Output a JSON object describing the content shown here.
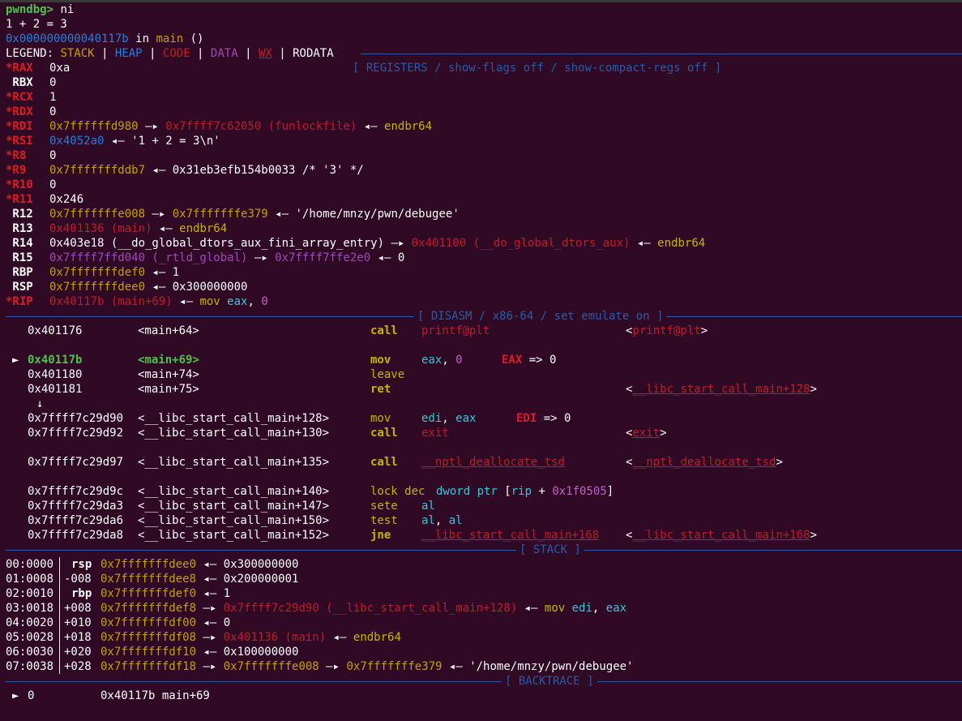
{
  "header": {
    "prompt": "pwndbg> ",
    "command": "ni",
    "output": "1 + 2 = 3",
    "location_addr": "0x000000000040117b",
    "location_in": " in ",
    "location_func": "main",
    "location_args": " ()"
  },
  "legend": {
    "label": "LEGEND: ",
    "stack": "STACK",
    "heap": "HEAP",
    "code": "CODE",
    "data": "DATA",
    "wx": "WX",
    "rodata": "RODATA",
    "sep": " | "
  },
  "sections": {
    "registers": "[ REGISTERS / show-flags off / show-compact-regs off ]",
    "disasm": "[ DISASM / x86-64 / set emulate on ]",
    "stack": "[ STACK ]",
    "backtrace": "[ BACKTRACE ]"
  },
  "colors": {
    "background": "#300a24",
    "separator": "#2a5aa8",
    "changed_register": "#e01b24",
    "stack": "#c4a000",
    "heap": "#2a7bde",
    "code": "#c01c28",
    "data": "#a347ba",
    "instruction": "#c4b500",
    "current": "#4ec24e"
  },
  "registers": [
    {
      "name": "*RAX",
      "changed": true,
      "parts": [
        {
          "t": "0xa",
          "c": "white"
        }
      ]
    },
    {
      "name": " RBX",
      "changed": false,
      "parts": [
        {
          "t": "0",
          "c": "white"
        }
      ]
    },
    {
      "name": "*RCX",
      "changed": true,
      "parts": [
        {
          "t": "1",
          "c": "white"
        }
      ]
    },
    {
      "name": "*RDX",
      "changed": true,
      "parts": [
        {
          "t": "0",
          "c": "white"
        }
      ]
    },
    {
      "name": "*RDI",
      "changed": true,
      "parts": [
        {
          "t": "0x7ffffffd980",
          "c": "stack"
        },
        {
          "t": " —▸ ",
          "c": "white"
        },
        {
          "t": "0x7ffff7c62050 (funlockfile)",
          "c": "code"
        },
        {
          "t": " ◂— ",
          "c": "white"
        },
        {
          "t": "endbr64",
          "c": "yellow"
        }
      ]
    },
    {
      "name": "*RSI",
      "changed": true,
      "parts": [
        {
          "t": "0x4052a0",
          "c": "heap"
        },
        {
          "t": " ◂— '1 + 2 = 3\\n'",
          "c": "white"
        }
      ]
    },
    {
      "name": "*R8",
      "changed": true,
      "parts": [
        {
          "t": "0",
          "c": "white"
        }
      ]
    },
    {
      "name": "*R9",
      "changed": true,
      "parts": [
        {
          "t": "0x7fffffffddb7",
          "c": "stack"
        },
        {
          "t": " ◂— 0x31eb3efb154b0033 /* '3' */",
          "c": "white"
        }
      ]
    },
    {
      "name": "*R10",
      "changed": true,
      "parts": [
        {
          "t": "0",
          "c": "white"
        }
      ]
    },
    {
      "name": "*R11",
      "changed": true,
      "parts": [
        {
          "t": "0x246",
          "c": "white"
        }
      ]
    },
    {
      "name": " R12",
      "changed": false,
      "parts": [
        {
          "t": "0x7fffffffe008",
          "c": "stack"
        },
        {
          "t": " —▸ ",
          "c": "white"
        },
        {
          "t": "0x7fffffffe379",
          "c": "stack"
        },
        {
          "t": " ◂— '/home/mnzy/pwn/debugee'",
          "c": "white"
        }
      ]
    },
    {
      "name": " R13",
      "changed": false,
      "parts": [
        {
          "t": "0x401136 (main)",
          "c": "code"
        },
        {
          "t": " ◂— ",
          "c": "white"
        },
        {
          "t": "endbr64",
          "c": "yellow"
        }
      ]
    },
    {
      "name": " R14",
      "changed": false,
      "parts": [
        {
          "t": "0x403e18 (__do_global_dtors_aux_fini_array_entry)",
          "c": "white"
        },
        {
          "t": " —▸ ",
          "c": "white"
        },
        {
          "t": "0x401100 (__do_global_dtors_aux)",
          "c": "code"
        },
        {
          "t": " ◂— ",
          "c": "white"
        },
        {
          "t": "endbr64",
          "c": "yellow"
        }
      ]
    },
    {
      "name": " R15",
      "changed": false,
      "parts": [
        {
          "t": "0x7ffff7ffd040 (_rtld_global)",
          "c": "data"
        },
        {
          "t": " —▸ ",
          "c": "white"
        },
        {
          "t": "0x7ffff7ffe2e0",
          "c": "data"
        },
        {
          "t": " ◂— 0",
          "c": "white"
        }
      ]
    },
    {
      "name": " RBP",
      "changed": false,
      "parts": [
        {
          "t": "0x7fffffffdef0",
          "c": "stack"
        },
        {
          "t": " ◂— 1",
          "c": "white"
        }
      ]
    },
    {
      "name": " RSP",
      "changed": false,
      "parts": [
        {
          "t": "0x7fffffffdee0",
          "c": "stack"
        },
        {
          "t": " ◂— 0x300000000",
          "c": "white"
        }
      ]
    },
    {
      "name": "*RIP",
      "changed": true,
      "parts": [
        {
          "t": "0x40117b (main+69)",
          "c": "code"
        },
        {
          "t": " ◂— ",
          "c": "white"
        },
        {
          "t": "mov ",
          "c": "yellow"
        },
        {
          "t": "eax",
          "c": "cyan"
        },
        {
          "t": ", ",
          "c": "white"
        },
        {
          "t": "0",
          "c": "purple"
        }
      ]
    }
  ],
  "disasm": [
    {
      "arrow": "",
      "addr": "0x401176",
      "sym": "<main+64>",
      "mn": "call",
      "mnc": "yellow",
      "op": [
        {
          "t": "printf@plt",
          "c": "code"
        }
      ],
      "note": "",
      "tgt": "<printf@plt>",
      "tgtu": false,
      "current": false
    },
    {
      "blank": true
    },
    {
      "arrow": "►",
      "addr": "0x40117b",
      "sym": "<main+69>",
      "mn": "mov",
      "mnc": "yellow",
      "op": [
        {
          "t": "eax",
          "c": "cyan"
        },
        {
          "t": ", ",
          "c": "white"
        },
        {
          "t": "0",
          "c": "purple"
        }
      ],
      "note": "EAX => 0",
      "notepos": "a",
      "tgt": "",
      "current": true
    },
    {
      "arrow": "",
      "addr": "0x401180",
      "sym": "<main+74>",
      "mn": "leave",
      "mnc": "yellow",
      "op": [],
      "note": "",
      "tgt": "",
      "current": false
    },
    {
      "arrow": "",
      "addr": "0x401181",
      "sym": "<main+75>",
      "mn": "ret",
      "mnc": "yellow",
      "op": [],
      "note": "",
      "tgt": "<__libc_start_call_main+128>",
      "tgtu": true,
      "current": false
    },
    {
      "arrow": "↓",
      "addr": "",
      "sym": "",
      "mn": "",
      "op": [],
      "note": "",
      "tgt": "",
      "current": false,
      "downonly": true
    },
    {
      "arrow": "",
      "addr": "0x7ffff7c29d90",
      "sym": "<__libc_start_call_main+128>",
      "mn": "mov",
      "mnc": "yellow",
      "op": [
        {
          "t": "edi",
          "c": "cyan"
        },
        {
          "t": ", ",
          "c": "white"
        },
        {
          "t": "eax",
          "c": "cyan"
        }
      ],
      "note": "EDI => 0",
      "notepos": "b",
      "tgt": "",
      "current": false
    },
    {
      "arrow": "",
      "addr": "0x7ffff7c29d92",
      "sym": "<__libc_start_call_main+130>",
      "mn": "call",
      "mnc": "yellow",
      "op": [
        {
          "t": "exit",
          "c": "code"
        }
      ],
      "note": "",
      "tgt": "<exit>",
      "tgtu": true,
      "current": false
    },
    {
      "blank": true
    },
    {
      "arrow": "",
      "addr": "0x7ffff7c29d97",
      "sym": "<__libc_start_call_main+135>",
      "mn": "call",
      "mnc": "yellow",
      "op": [
        {
          "t": "__nptl_deallocate_tsd",
          "c": "code",
          "u": true
        }
      ],
      "note": "",
      "tgt": "<__nptl_deallocate_tsd>",
      "tgtu": true,
      "current": false
    },
    {
      "blank": true
    },
    {
      "arrow": "",
      "addr": "0x7ffff7c29d9c",
      "sym": "<__libc_start_call_main+140>",
      "mn": "lock dec",
      "mnc": "yellow",
      "op": [
        {
          "t": "dword ptr",
          "c": "cyan"
        },
        {
          "t": " [",
          "c": "white"
        },
        {
          "t": "rip",
          "c": "cyan"
        },
        {
          "t": " + ",
          "c": "white"
        },
        {
          "t": "0x1f0505",
          "c": "purple"
        },
        {
          "t": "]",
          "c": "white"
        }
      ],
      "note": "",
      "tgt": "",
      "current": false,
      "lock": true
    },
    {
      "arrow": "",
      "addr": "0x7ffff7c29da3",
      "sym": "<__libc_start_call_main+147>",
      "mn": "sete",
      "mnc": "yellow",
      "op": [
        {
          "t": "al",
          "c": "cyan"
        }
      ],
      "note": "",
      "tgt": "",
      "current": false
    },
    {
      "arrow": "",
      "addr": "0x7ffff7c29da6",
      "sym": "<__libc_start_call_main+150>",
      "mn": "test",
      "mnc": "yellow",
      "op": [
        {
          "t": "al",
          "c": "cyan"
        },
        {
          "t": ", ",
          "c": "white"
        },
        {
          "t": "al",
          "c": "cyan"
        }
      ],
      "note": "",
      "tgt": "",
      "current": false
    },
    {
      "arrow": "",
      "addr": "0x7ffff7c29da8",
      "sym": "<__libc_start_call_main+152>",
      "mn": "jne",
      "mnc": "yellow",
      "op": [
        {
          "t": "__libc_start_call_main+168",
          "c": "code",
          "u": true
        }
      ],
      "note": "",
      "tgt": "<__libc_start_call_main+168>",
      "tgtu": true,
      "current": false
    }
  ],
  "stack": [
    {
      "idx": "00:0000",
      "reg": "rsp",
      "off": "",
      "parts": [
        {
          "t": "0x7fffffffdee0",
          "c": "stack"
        },
        {
          "t": " ◂— 0x300000000",
          "c": "white"
        }
      ]
    },
    {
      "idx": "01:0008",
      "reg": "",
      "off": "-008",
      "parts": [
        {
          "t": "0x7fffffffdee8",
          "c": "stack"
        },
        {
          "t": " ◂— 0x200000001",
          "c": "white"
        }
      ]
    },
    {
      "idx": "02:0010",
      "reg": "rbp",
      "off": "",
      "parts": [
        {
          "t": "0x7fffffffdef0",
          "c": "stack"
        },
        {
          "t": " ◂— 1",
          "c": "white"
        }
      ]
    },
    {
      "idx": "03:0018",
      "reg": "",
      "off": "+008",
      "parts": [
        {
          "t": "0x7fffffffdef8",
          "c": "stack"
        },
        {
          "t": " —▸ ",
          "c": "white"
        },
        {
          "t": "0x7ffff7c29d90 (__libc_start_call_main+128)",
          "c": "code"
        },
        {
          "t": " ◂— ",
          "c": "white"
        },
        {
          "t": "mov ",
          "c": "yellow"
        },
        {
          "t": "edi",
          "c": "cyan"
        },
        {
          "t": ", ",
          "c": "white"
        },
        {
          "t": "eax",
          "c": "cyan"
        }
      ]
    },
    {
      "idx": "04:0020",
      "reg": "",
      "off": "+010",
      "parts": [
        {
          "t": "0x7fffffffdf00",
          "c": "stack"
        },
        {
          "t": " ◂— 0",
          "c": "white"
        }
      ]
    },
    {
      "idx": "05:0028",
      "reg": "",
      "off": "+018",
      "parts": [
        {
          "t": "0x7fffffffdf08",
          "c": "stack"
        },
        {
          "t": " —▸ ",
          "c": "white"
        },
        {
          "t": "0x401136 (main)",
          "c": "code"
        },
        {
          "t": " ◂— ",
          "c": "white"
        },
        {
          "t": "endbr64",
          "c": "yellow"
        }
      ]
    },
    {
      "idx": "06:0030",
      "reg": "",
      "off": "+020",
      "parts": [
        {
          "t": "0x7fffffffdf10",
          "c": "stack"
        },
        {
          "t": " ◂— 0x100000000",
          "c": "white"
        }
      ]
    },
    {
      "idx": "07:0038",
      "reg": "",
      "off": "+028",
      "parts": [
        {
          "t": "0x7fffffffdf18",
          "c": "stack"
        },
        {
          "t": " —▸ ",
          "c": "white"
        },
        {
          "t": "0x7fffffffe008",
          "c": "stack"
        },
        {
          "t": " —▸ ",
          "c": "white"
        },
        {
          "t": "0x7fffffffe379",
          "c": "stack"
        },
        {
          "t": " ◂— '/home/mnzy/pwn/debugee'",
          "c": "white"
        }
      ]
    }
  ],
  "backtrace": [
    {
      "arrow": "►",
      "idx": "0",
      "val": "0x40117b main+69"
    }
  ]
}
